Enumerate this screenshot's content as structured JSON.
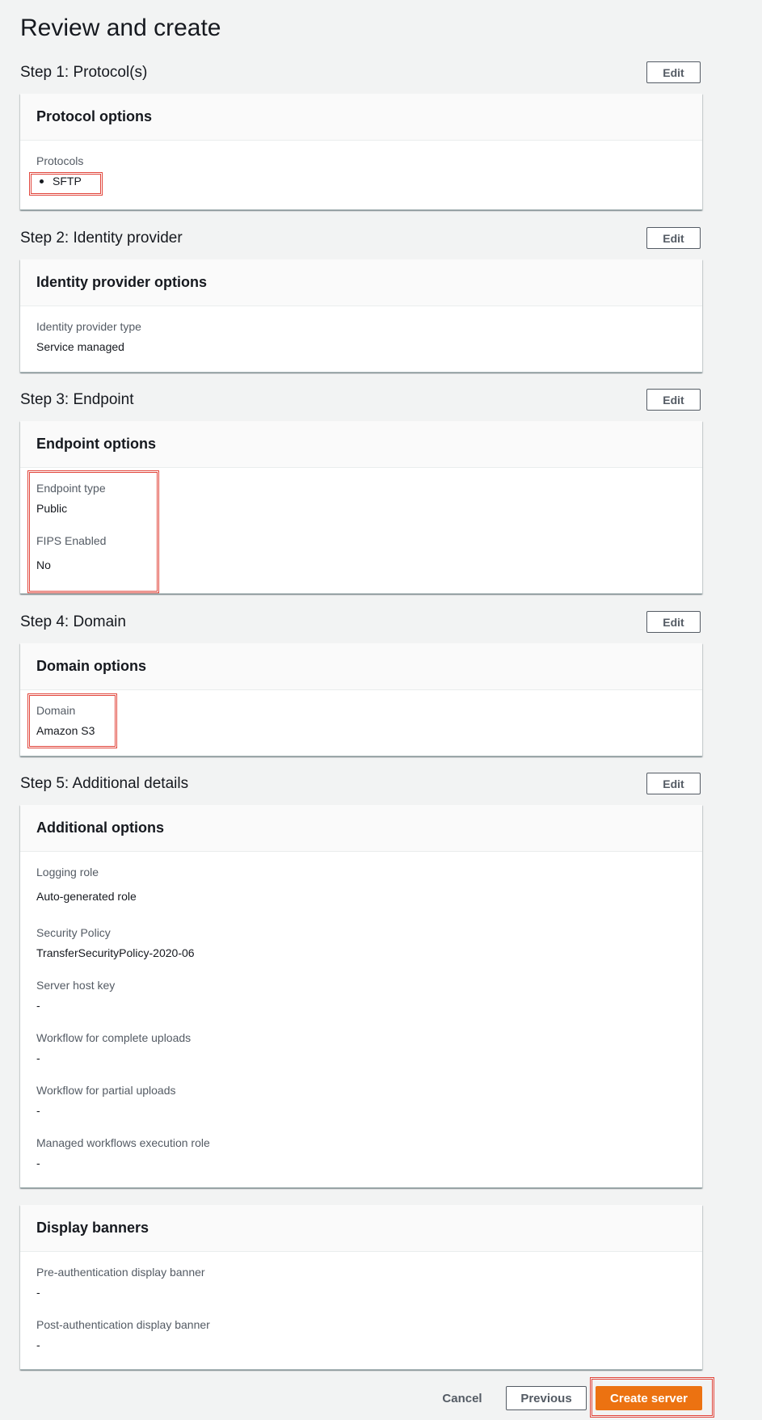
{
  "page": {
    "title": "Review and create"
  },
  "steps": [
    {
      "title": "Step 1: Protocol(s)",
      "edit_label": "Edit"
    },
    {
      "title": "Step 2: Identity provider",
      "edit_label": "Edit"
    },
    {
      "title": "Step 3: Endpoint",
      "edit_label": "Edit"
    },
    {
      "title": "Step 4: Domain",
      "edit_label": "Edit"
    },
    {
      "title": "Step 5: Additional details",
      "edit_label": "Edit"
    }
  ],
  "protocol_options": {
    "heading": "Protocol options",
    "protocols_label": "Protocols",
    "protocols": [
      "SFTP"
    ]
  },
  "identity_options": {
    "heading": "Identity provider options",
    "type_label": "Identity provider type",
    "type_value": "Service managed"
  },
  "endpoint_options": {
    "heading": "Endpoint options",
    "type_label": "Endpoint type",
    "type_value": "Public",
    "fips_label": "FIPS Enabled",
    "fips_value": "No"
  },
  "domain_options": {
    "heading": "Domain options",
    "domain_label": "Domain",
    "domain_value": "Amazon S3"
  },
  "additional_options": {
    "heading": "Additional options",
    "fields": [
      {
        "label": "Logging role",
        "value": "Auto-generated role"
      },
      {
        "label": "Security Policy",
        "value": "TransferSecurityPolicy-2020-06"
      },
      {
        "label": "Server host key",
        "value": "-"
      },
      {
        "label": "Workflow for complete uploads",
        "value": "-"
      },
      {
        "label": "Workflow for partial uploads",
        "value": "-"
      },
      {
        "label": "Managed workflows execution role",
        "value": "-"
      }
    ]
  },
  "display_banners": {
    "heading": "Display banners",
    "fields": [
      {
        "label": "Pre-authentication display banner",
        "value": "-"
      },
      {
        "label": "Post-authentication display banner",
        "value": "-"
      }
    ]
  },
  "footer": {
    "cancel_label": "Cancel",
    "previous_label": "Previous",
    "create_label": "Create server"
  },
  "colors": {
    "primary_button": "#ec7211",
    "highlight_box": "#e1453b",
    "page_bg": "#f2f3f3"
  }
}
